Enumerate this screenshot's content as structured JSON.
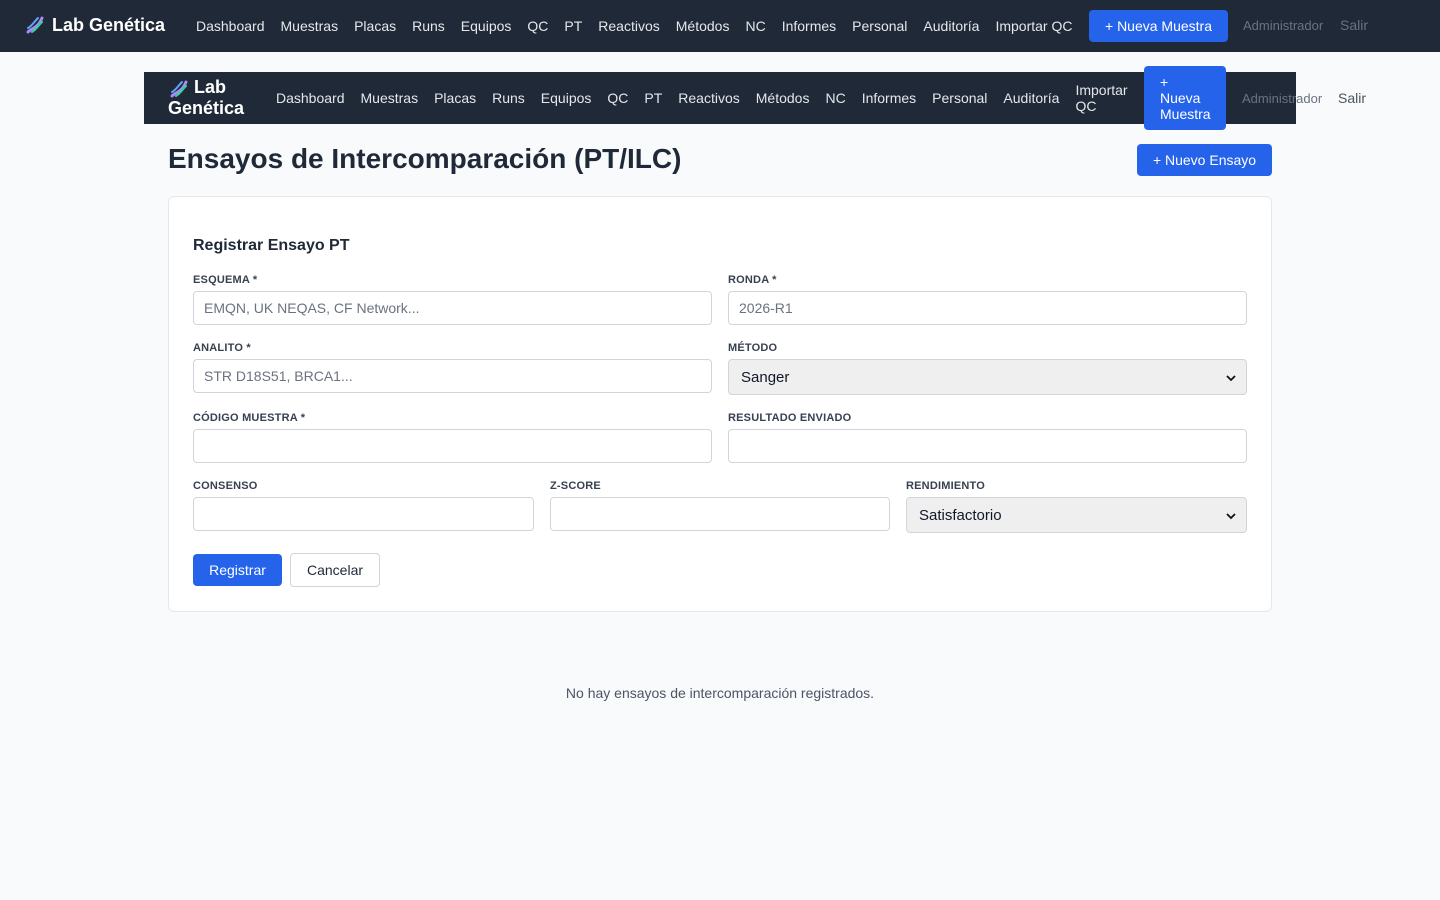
{
  "brand": "Lab Genética",
  "brand_line1": "Lab",
  "brand_line2": "Genética",
  "nav": [
    "Dashboard",
    "Muestras",
    "Placas",
    "Runs",
    "Equipos",
    "QC",
    "PT",
    "Reactivos",
    "Métodos",
    "NC",
    "Informes",
    "Personal",
    "Auditoría",
    "Importar QC"
  ],
  "nav_new_sample": "+ Nueva Muestra",
  "nav_new_sample_wrapped": [
    "+",
    "Nueva",
    "Muestra"
  ],
  "user": "Administrador",
  "logout": "Salir",
  "page_title": "Ensayos de Intercomparación (PT/ILC)",
  "new_trial_button": "+ Nuevo Ensayo",
  "form": {
    "title": "Registrar Ensayo PT",
    "esquema": {
      "label": "ESQUEMA *",
      "placeholder": "EMQN, UK NEQAS, CF Network..."
    },
    "ronda": {
      "label": "RONDA *",
      "placeholder": "2026-R1"
    },
    "analito": {
      "label": "ANALITO *",
      "placeholder": "STR D18S51, BRCA1..."
    },
    "metodo": {
      "label": "MÉTODO",
      "value": "Sanger"
    },
    "codigo": {
      "label": "CÓDIGO MUESTRA *",
      "placeholder": ""
    },
    "resultado": {
      "label": "RESULTADO ENVIADO",
      "placeholder": ""
    },
    "consenso": {
      "label": "CONSENSO",
      "placeholder": ""
    },
    "zscore": {
      "label": "Z-SCORE",
      "placeholder": ""
    },
    "rendimiento": {
      "label": "RENDIMIENTO",
      "value": "Satisfactorio"
    },
    "submit": "Registrar",
    "cancel": "Cancelar"
  },
  "empty_message": "No hay ensayos de intercomparación registrados.",
  "colors": {
    "navbar": "#1f2937",
    "primary": "#2563eb",
    "background": "#f8fafc"
  }
}
